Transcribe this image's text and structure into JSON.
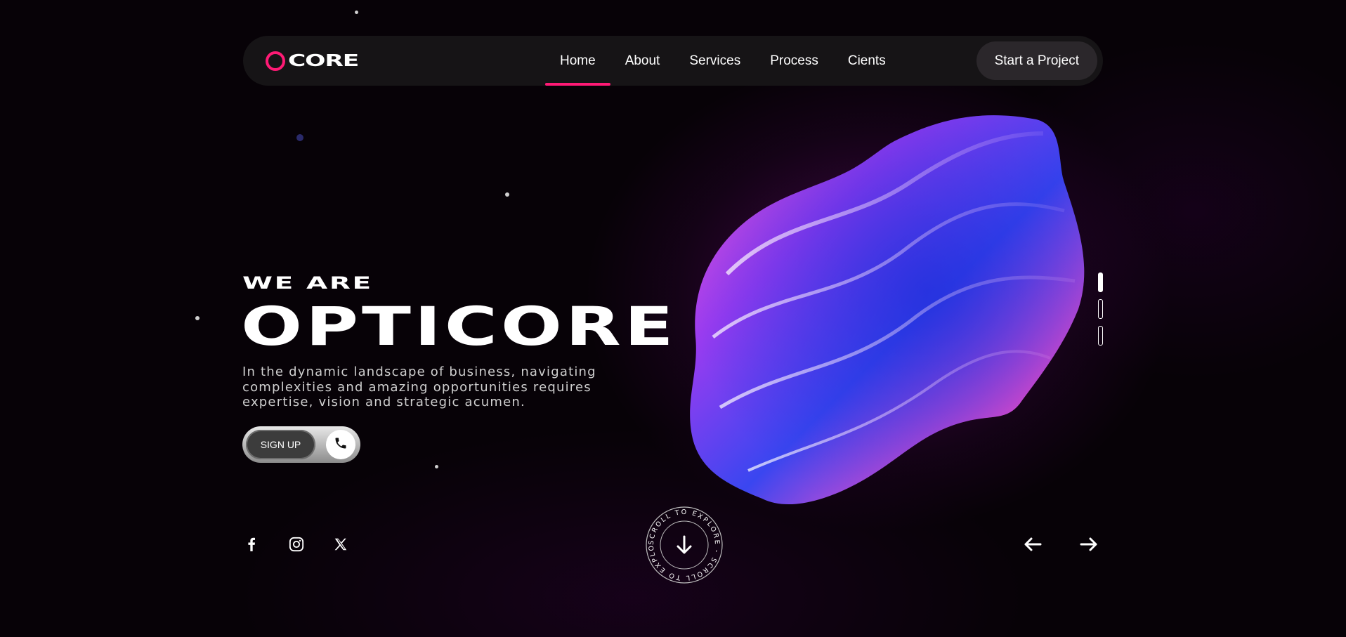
{
  "brand": {
    "logo_text": "CORE",
    "accent_color": "#ff1a75"
  },
  "nav": {
    "items": [
      {
        "label": "Home",
        "active": true
      },
      {
        "label": "About",
        "active": false
      },
      {
        "label": "Services",
        "active": false
      },
      {
        "label": "Process",
        "active": false
      },
      {
        "label": "Cients",
        "active": false
      }
    ],
    "cta_label": "Start a Project"
  },
  "hero": {
    "pre_title": "WE ARE",
    "title": "OPTICORE",
    "description": "In the dynamic landscape of business, navigating complexities and amazing opportunities requires expertise, vision and strategic acumen.",
    "signup_label": "SIGN UP",
    "call_icon": "phone-icon"
  },
  "slider": {
    "slide_count": 3,
    "active_index": 0
  },
  "social": [
    {
      "name": "facebook-icon"
    },
    {
      "name": "instagram-icon"
    },
    {
      "name": "x-twitter-icon"
    }
  ],
  "scroll": {
    "ring_text": "SCROLL TO EXPLORE - SCROLL TO EXPLORE - "
  },
  "carousel_nav": {
    "prev_icon": "arrow-left-icon",
    "next_icon": "arrow-right-icon"
  }
}
